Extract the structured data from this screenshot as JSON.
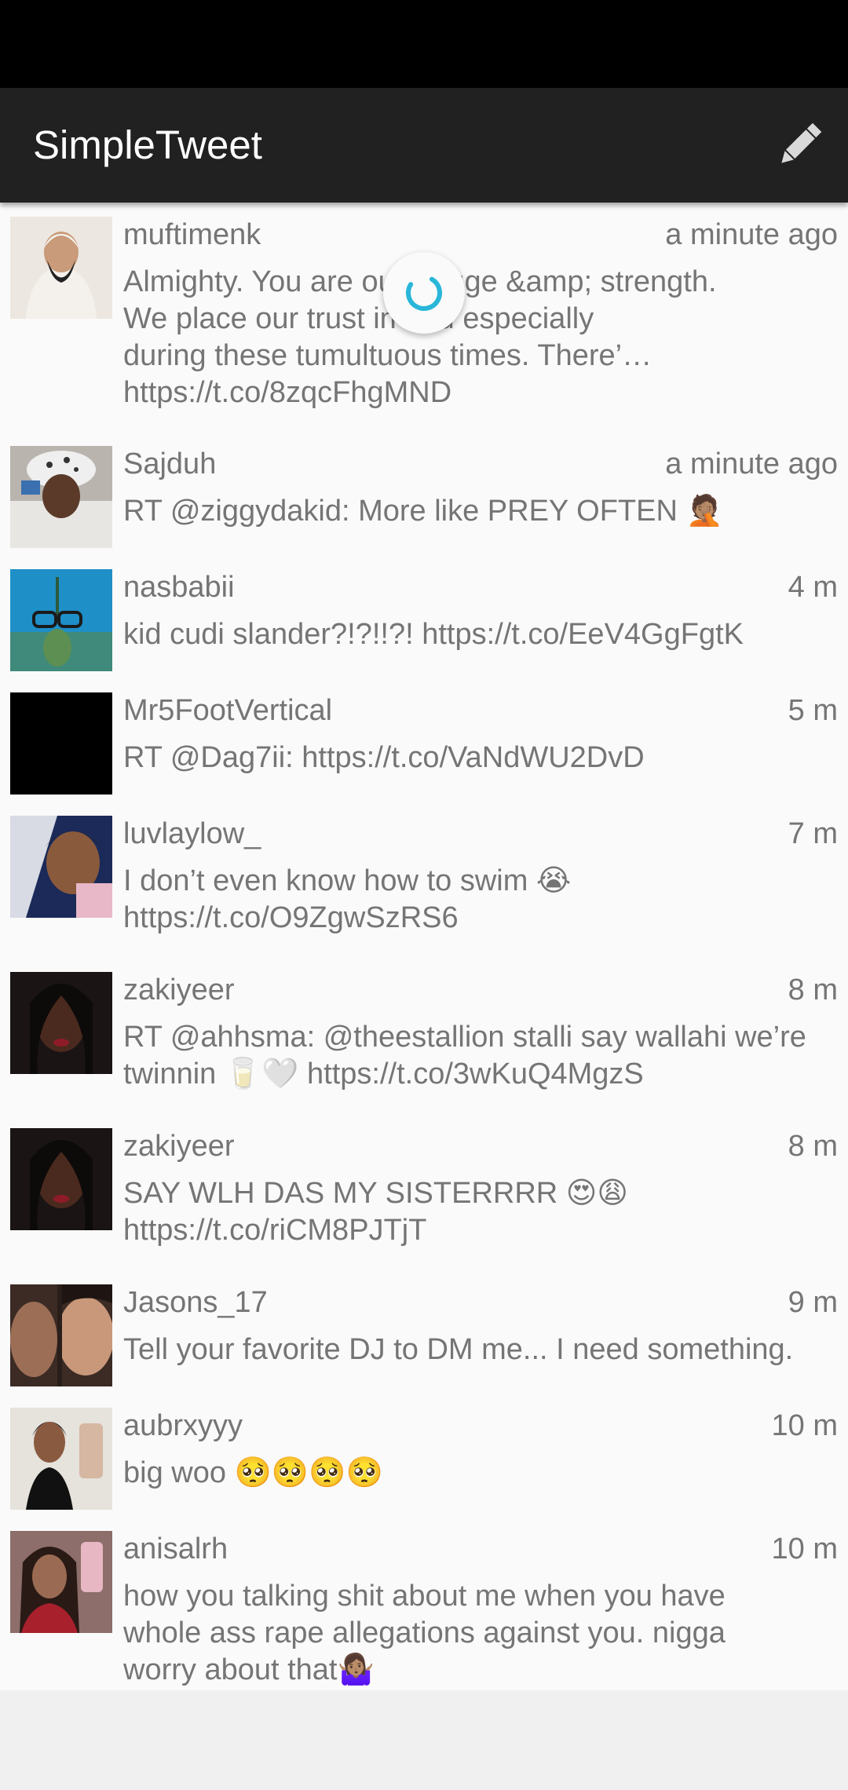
{
  "app": {
    "title": "SimpleTweet",
    "compose_icon": "pencil-icon",
    "loading_icon": "refresh-spinner-icon"
  },
  "colors": {
    "status_bar": "#000000",
    "app_bar": "#212121",
    "timeline_background": "#fafafa",
    "text_secondary": "#757575",
    "spinner_accent": "#29b6d8"
  },
  "tweets": [
    {
      "username": "muftimenk",
      "time": "a minute ago",
      "text": "Almighty. You are our refuge &amp; strength.\nWe place our trust in You especially\nduring these tumultuous times. There’…\nhttps://t.co/8zqcFhgMND"
    },
    {
      "username": "Sajduh",
      "time": "a minute ago",
      "text": "RT @ziggydakid: More like PREY OFTEN 🤦🏽"
    },
    {
      "username": "nasbabii",
      "time": "4 m",
      "text": "kid cudi slander?!?!!?! https://t.co/EeV4GgFgtK"
    },
    {
      "username": "Mr5FootVertical",
      "time": "5 m",
      "text": "RT @Dag7ii: https://t.co/VaNdWU2DvD"
    },
    {
      "username": "luvlaylow_",
      "time": "7 m",
      "text": "I don’t even know how to swim 😭\nhttps://t.co/O9ZgwSzRS6"
    },
    {
      "username": "zakiyeer",
      "time": "8 m",
      "text": "RT @ahhsma: @theestallion stalli say wallahi we’re\ntwinnin 🥛🤍 https://t.co/3wKuQ4MgzS"
    },
    {
      "username": "zakiyeer",
      "time": "8 m",
      "text": "SAY WLH DAS MY SISTERRRR 😍😩\nhttps://t.co/riCM8PJTjT"
    },
    {
      "username": "Jasons_17",
      "time": "9 m",
      "text": "Tell your favorite DJ to DM me... I need something."
    },
    {
      "username": "aubrxyyy",
      "time": "10 m",
      "text": "big woo 🥺🥺🥺🥺"
    },
    {
      "username": "anisalrh",
      "time": "10 m",
      "text": "how you talking shit about me when you have\nwhole ass rape allegations against you. nigga\nworry about that🤷🏽‍♀️"
    }
  ]
}
